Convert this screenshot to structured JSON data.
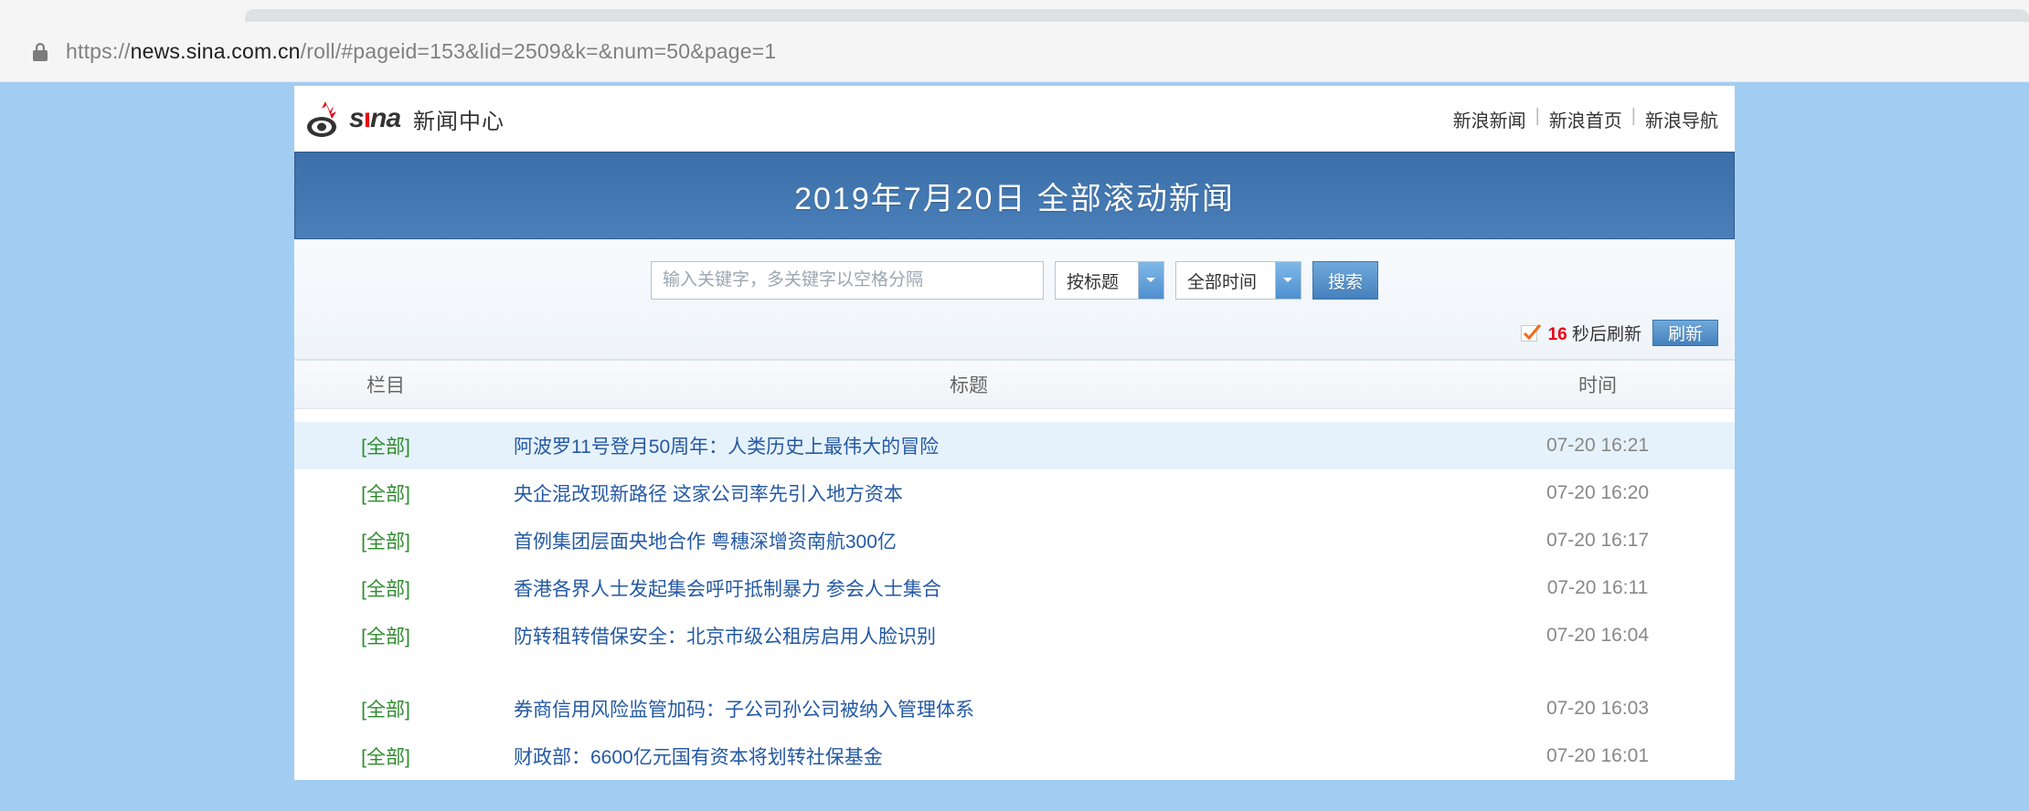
{
  "browser": {
    "url_prefix": "https://",
    "url_host": "news.sina.com.cn",
    "url_path": "/roll/#pageid=153&lid=2509&k=&num=50&page=1"
  },
  "header": {
    "logo_text_a": "s",
    "logo_text_b": "na",
    "logo_cn": "新闻中心",
    "links": [
      "新浪新闻",
      "新浪首页",
      "新浪导航"
    ]
  },
  "banner": {
    "title": "2019年7月20日  全部滚动新闻"
  },
  "toolbar": {
    "search_placeholder": "输入关键字，多关键字以空格分隔",
    "select_by": "按标题",
    "select_time": "全部时间",
    "search_btn": "搜索",
    "countdown": "16",
    "countdown_suffix": " 秒后刷新",
    "refresh_btn": "刷新"
  },
  "columns": {
    "cat": "栏目",
    "title": "标题",
    "time": "时间"
  },
  "rows_group1": [
    {
      "cat": "[全部]",
      "title": "阿波罗11号登月50周年：人类历史上最伟大的冒险",
      "time": "07-20 16:21",
      "highlight": true
    },
    {
      "cat": "[全部]",
      "title": "央企混改现新路径 这家公司率先引入地方资本",
      "time": "07-20 16:20"
    },
    {
      "cat": "[全部]",
      "title": "首例集团层面央地合作 粤穗深增资南航300亿",
      "time": "07-20 16:17"
    },
    {
      "cat": "[全部]",
      "title": "香港各界人士发起集会呼吁抵制暴力 参会人士集合",
      "time": "07-20 16:11"
    },
    {
      "cat": "[全部]",
      "title": "防转租转借保安全：北京市级公租房启用人脸识别",
      "time": "07-20 16:04"
    }
  ],
  "rows_group2": [
    {
      "cat": "[全部]",
      "title": "券商信用风险监管加码：子公司孙公司被纳入管理体系",
      "time": "07-20 16:03"
    },
    {
      "cat": "[全部]",
      "title": "财政部：6600亿元国有资本将划转社保基金",
      "time": "07-20 16:01"
    }
  ]
}
